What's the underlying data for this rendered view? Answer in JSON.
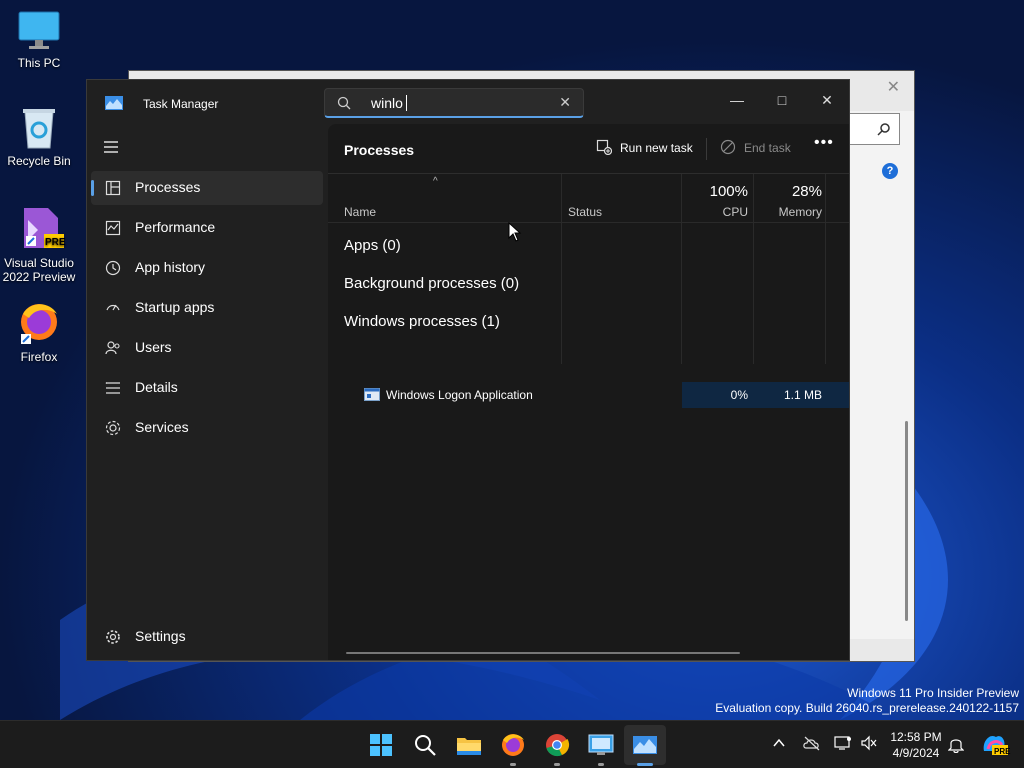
{
  "desktop": {
    "icons": [
      {
        "label": "This PC"
      },
      {
        "label": "Recycle Bin"
      },
      {
        "label": "Visual Studio 2022 Preview",
        "badge": "PRE"
      },
      {
        "label": "Firefox"
      }
    ],
    "watermark": {
      "line1": "Windows 11 Pro Insider Preview",
      "line2": "Evaluation copy. Build 26040.rs_prerelease.240122-1157"
    }
  },
  "taskmanager": {
    "title": "Task Manager",
    "search": {
      "value": "winlo",
      "clear": "✕"
    },
    "controls": {
      "minimize": "—",
      "maximize": "□",
      "close": "✕"
    },
    "nav": [
      {
        "label": "Processes",
        "icon": "processes-icon",
        "active": true
      },
      {
        "label": "Performance",
        "icon": "performance-icon"
      },
      {
        "label": "App history",
        "icon": "app-history-icon"
      },
      {
        "label": "Startup apps",
        "icon": "startup-apps-icon"
      },
      {
        "label": "Users",
        "icon": "users-icon"
      },
      {
        "label": "Details",
        "icon": "details-icon"
      },
      {
        "label": "Services",
        "icon": "services-icon"
      }
    ],
    "settings": "Settings",
    "page_title": "Processes",
    "toolbar": {
      "run_new_task": "Run new task",
      "end_task": "End task",
      "more": "•••"
    },
    "columns": {
      "sort_arrow": "^",
      "name": "Name",
      "status": "Status",
      "cpu": {
        "pct": "100%",
        "label": "CPU"
      },
      "memory": {
        "pct": "28%",
        "label": "Memory"
      }
    },
    "groups": {
      "apps": "Apps (0)",
      "background": "Background processes (0)",
      "windows": "Windows processes (1)"
    },
    "process": {
      "name": "Windows Logon Application",
      "cpu": "0%",
      "memory": "1.1 MB"
    }
  },
  "taskbar": {
    "clock": {
      "time": "12:58 PM",
      "date": "4/9/2024"
    },
    "copilot_badge": "PRE"
  },
  "colors": {
    "accent": "#5aa0e6",
    "bg": "#202020",
    "content": "#191919",
    "highlight": "#0f2742"
  }
}
